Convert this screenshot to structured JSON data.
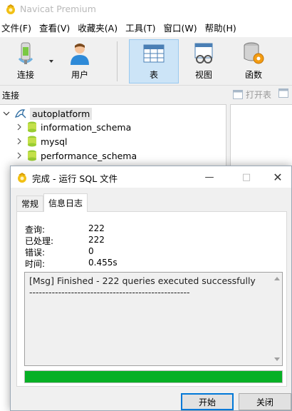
{
  "window": {
    "title": "Navicat Premium"
  },
  "menu": [
    "文件(F)",
    "查看(V)",
    "收藏夹(A)",
    "工具(T)",
    "窗口(W)",
    "帮助(H)"
  ],
  "toolbar": {
    "connect": "连接",
    "user": "用户",
    "table": "表",
    "view": "视图",
    "function": "函数"
  },
  "conn_header": {
    "label": "连接",
    "open_table": "打开表"
  },
  "tree": {
    "root": "autoplatform",
    "items": [
      "information_schema",
      "mysql",
      "performance_schema"
    ]
  },
  "dialog": {
    "title": "完成 - 运行 SQL 文件",
    "tabs": [
      "常规",
      "信息日志"
    ],
    "active_tab": 1,
    "stats": [
      {
        "label": "查询:",
        "value": "222"
      },
      {
        "label": "已处理:",
        "value": "222"
      },
      {
        "label": "错误:",
        "value": "0"
      },
      {
        "label": "时间:",
        "value": "0.455s"
      }
    ],
    "log": [
      "[Msg] Finished - 222 queries executed successfully",
      "--------------------------------------------------"
    ],
    "progress_percent": 100,
    "start_button": "开始",
    "close_button": "关闭"
  },
  "colors": {
    "accent": "#0078d7",
    "progress": "#06b025",
    "selected_toolbar": "#cce4f7"
  }
}
